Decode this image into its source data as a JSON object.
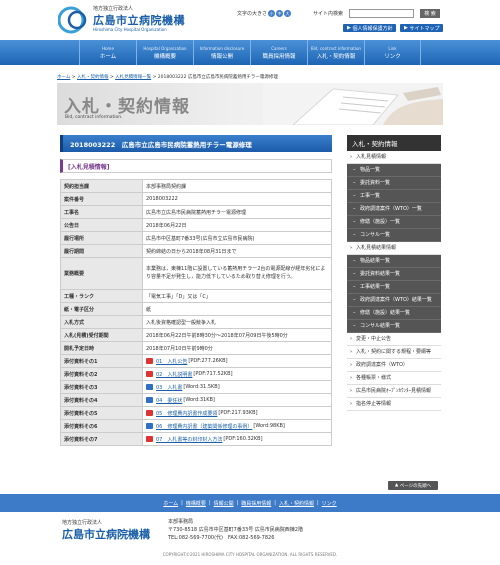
{
  "header": {
    "org_sub": "地方独立行政法人",
    "org_name": "広島市立病院機構",
    "org_en": "Hiroshima City Hospital Organization",
    "font_size_label": "文字の大きさ",
    "font_sizes": [
      "小",
      "中",
      "大"
    ],
    "search_label": "サイト内検索",
    "search_button": "検 索",
    "links": [
      "個人情報保護方針",
      "サイトマップ"
    ]
  },
  "nav": [
    {
      "en": "Home",
      "ja": "ホーム"
    },
    {
      "en": "Hospital Organization",
      "ja": "機構概要"
    },
    {
      "en": "Information disclosure",
      "ja": "情報公開"
    },
    {
      "en": "Careers",
      "ja": "職員採用情報"
    },
    {
      "en": "Bid, contract information",
      "ja": "入札・契約情報"
    },
    {
      "en": "Link",
      "ja": "リンク"
    }
  ],
  "breadcrumb": {
    "items": [
      "ホーム",
      "入札・契約情報",
      "入札見積情報一覧",
      "2018003222"
    ],
    "current": "広島市立広島市民病院蓄熱用チラー電源修理"
  },
  "banner": {
    "title": "入札・契約情報",
    "en": "Bid, contract information."
  },
  "page_title": "2018003222　広島市立広島市民病院蓄熱用チラー電源修理",
  "section_heading": "[入札見積情報]",
  "rows": [
    {
      "label": "契約担当課",
      "value": "本部事務局契約課"
    },
    {
      "label": "案件番号",
      "value": "2018003222"
    },
    {
      "label": "工事名",
      "value": "広島市立広島市民病院蓄熱用チラー電源修理"
    },
    {
      "label": "公告日",
      "value": "2018年06月22日"
    },
    {
      "label": "履行場所",
      "value": "広島市中区基町7番33号(広島市立広島市民病院)"
    },
    {
      "label": "履行期間",
      "value": "契約締結の日から2018年08月31日まで"
    },
    {
      "label": "業務概要",
      "value": "本業務は，東棟11階に設置している蓄熱用チラー2台の電源配線が経年劣化により容量不足が発生し，能力低下しているため取り替え修理を行う。"
    },
    {
      "label": "工種・ランク",
      "value": "「電気工事」「D」又は「C」"
    },
    {
      "label": "紙・電子区分",
      "value": "紙"
    },
    {
      "label": "入札方式",
      "value": "入札後資格確認型一般競争入札"
    },
    {
      "label": "入札(見積)受付期間",
      "value": "2018年06月22日午前8時30分～2018年07月09日午後5時0分"
    },
    {
      "label": "開札予定日時",
      "value": "2018年07月10日午前9時0分"
    }
  ],
  "attachments": [
    {
      "label": "添付資料その1",
      "type": "pdf",
      "link": "01　入札公告",
      "info": "[PDF:277.26KB]"
    },
    {
      "label": "添付資料その2",
      "type": "pdf",
      "link": "02　入札説明書",
      "info": "[PDF:717.52KB]"
    },
    {
      "label": "添付資料その3",
      "type": "doc",
      "link": "03　入札書",
      "info": "[Word:31.5KB]"
    },
    {
      "label": "添付資料その4",
      "type": "doc",
      "link": "04　委任状",
      "info": "[Word:31KB]"
    },
    {
      "label": "添付資料その5",
      "type": "pdf",
      "link": "05　修理費内訳書作成要領",
      "info": "[PDF:217.93KB]"
    },
    {
      "label": "添付資料その6",
      "type": "doc",
      "link": "06　修理費内訳書（建築関係修理の事例）",
      "info": "[Word:98KB]"
    },
    {
      "label": "添付資料その7",
      "type": "pdf",
      "link": "07　入札書等の封印封入方法",
      "info": "[PDF:160.32KB]"
    }
  ],
  "sidebar": {
    "heading": "入札・契約情報",
    "groups": [
      {
        "title": "入札見積情報",
        "items": [
          "物品一覧",
          "委託資料一覧",
          "工事一覧",
          "政府調達案件（WTO）一覧",
          "修繕（施設）一覧",
          "コンサル一覧"
        ]
      },
      {
        "title": "入札見積結果情報",
        "items": [
          "物品結果一覧",
          "委託資料結果一覧",
          "工事結果一覧",
          "政府調達案件（WTO）結果一覧",
          "修繕（施設）結果一覧",
          "コンサル結果一覧"
        ]
      }
    ],
    "extra": [
      "変更・中止公告",
      "入札・契約に関する規程・要綱等",
      "政府調達案件（WTO）",
      "各種帳票・様式",
      "広島市民病院ｵｰﾌﾟﾝｶｳﾝﾀｰ見積情報",
      "指名停止等情報"
    ]
  },
  "page_top": "ページの先頭へ",
  "footer": {
    "links": [
      "ホーム",
      "機構概要",
      "情報公開",
      "職員採用情報",
      "入札・契約情報",
      "リンク"
    ],
    "org_sub": "地方独立行政法人",
    "org_name": "広島市立病院機構",
    "office": "本部事務局",
    "address": "〒730-8518 広島市中区基町7番33号 広島市民病院西棟2階",
    "tel": "TEL:082-569-7700(代)　FAX:082-569-7826",
    "copyright": "COPYRIGHT©2021 HIROSHIMA CITY HOSPITAL ORGANIZATION. ALL RIGHTS RESERVED."
  },
  "colors": {
    "nav": "#1d65b4",
    "accent": "#7a3b8e",
    "sidebar_sub": "#555555"
  }
}
